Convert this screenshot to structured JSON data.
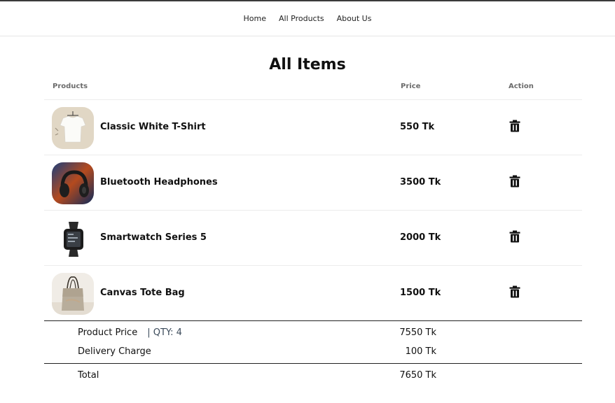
{
  "nav": {
    "links": [
      {
        "label": "Home"
      },
      {
        "label": "All Products"
      },
      {
        "label": "About Us"
      }
    ]
  },
  "page": {
    "title": "All Items"
  },
  "table": {
    "headers": {
      "products": "Products",
      "price": "Price",
      "action": "Action"
    },
    "rows": [
      {
        "name": "Classic White T-Shirt",
        "price": "550 Tk",
        "image": "tshirt-image"
      },
      {
        "name": "Bluetooth Headphones",
        "price": "3500 Tk",
        "image": "headphones-image"
      },
      {
        "name": "Smartwatch Series 5",
        "price": "2000 Tk",
        "image": "smartwatch-image"
      },
      {
        "name": "Canvas Tote Bag",
        "price": "1500 Tk",
        "image": "tote-bag-image"
      }
    ],
    "action_icon": "trash-icon"
  },
  "summary": {
    "product_price_label": "Product Price",
    "qty_text": "| QTY: 4",
    "product_price_value": "7550 Tk",
    "delivery_label": "Delivery Charge",
    "delivery_value": "100 Tk",
    "total_label": "Total",
    "total_value": "7650 Tk"
  },
  "colors": {
    "text": "#111111",
    "header_text": "#6b6b6b",
    "divider": "#ececec",
    "qty_text": "#3b4a5a"
  }
}
